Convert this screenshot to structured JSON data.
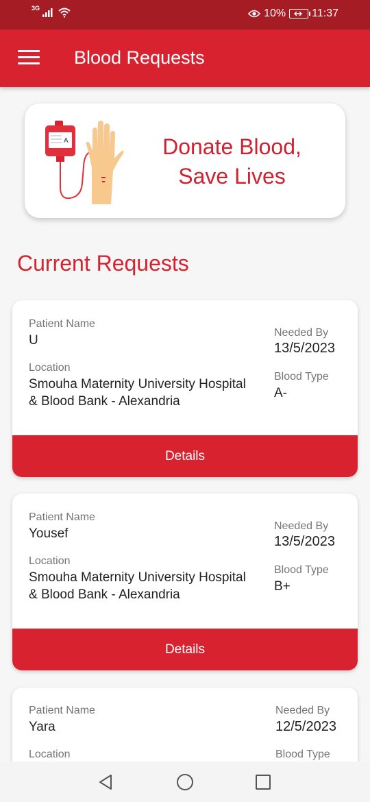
{
  "status_bar": {
    "network": "3G",
    "battery": "10%",
    "time": "11:37",
    "icons": [
      "signal-icon",
      "wifi-icon",
      "eye-icon",
      "battery-icon"
    ]
  },
  "app_bar": {
    "title": "Blood Requests",
    "menu_icon": "hamburger-menu-icon"
  },
  "banner": {
    "line1": "Donate Blood,",
    "line2": "Save Lives",
    "blood_bag_label": "A",
    "illustration": "blood-bag-hand-illustration"
  },
  "section_title": "Current Requests",
  "labels": {
    "patient_name": "Patient Name",
    "location": "Location",
    "needed_by": "Needed By",
    "blood_type": "Blood Type",
    "details": "Details"
  },
  "requests": [
    {
      "patient_name": "U",
      "location_line1": "Smouha Maternity University Hospital",
      "location_line2": "& Blood Bank - Alexandria",
      "needed_by": "13/5/2023",
      "blood_type": "A-"
    },
    {
      "patient_name": "Yousef",
      "location_line1": "Smouha Maternity University Hospital",
      "location_line2": "& Blood Bank - Alexandria",
      "needed_by": "13/5/2023",
      "blood_type": "B+"
    },
    {
      "patient_name": "Yara",
      "needed_by": "12/5/2023"
    }
  ],
  "nav_bar": {
    "buttons": [
      "back-icon",
      "home-icon",
      "recents-icon"
    ]
  },
  "colors": {
    "primary": "#d8222f",
    "status_bar": "#a51c24",
    "accent_text": "#cf2231"
  }
}
